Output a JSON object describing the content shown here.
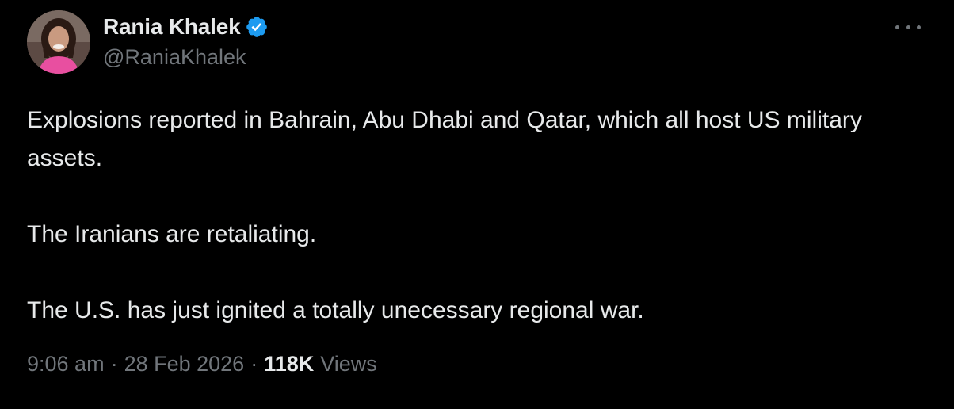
{
  "author": {
    "display_name": "Rania Khalek",
    "handle": "@RaniaKhalek",
    "verified_icon": "verified-badge-icon"
  },
  "tweet": {
    "paragraphs": [
      "Explosions reported in Bahrain, Abu Dhabi and Qatar, which all host US military assets.",
      "The Iranians are retaliating.",
      "The U.S. has just ignited a totally unecessary regional war."
    ],
    "time": "9:06 am",
    "date": "28 Feb 2026",
    "separator": "·",
    "views_count": "118K",
    "views_label": "Views"
  },
  "colors": {
    "background": "#000000",
    "text_primary": "#e7e9ea",
    "text_secondary": "#71767b",
    "verified_blue": "#1d9bf0",
    "divider": "#2f3336"
  }
}
